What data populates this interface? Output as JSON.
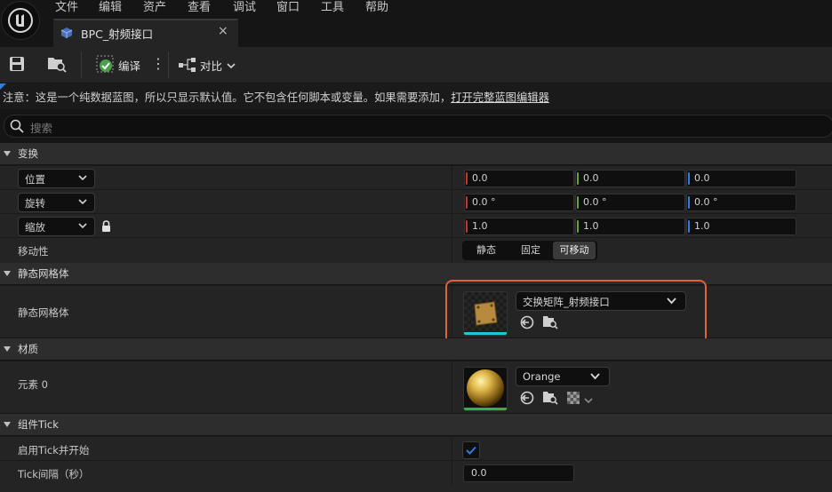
{
  "menu": [
    "文件",
    "编辑",
    "资产",
    "查看",
    "调试",
    "窗口",
    "工具",
    "帮助"
  ],
  "tab": {
    "title": "BPC_射频接口",
    "close": "×"
  },
  "toolbar": {
    "compile_label": "编译",
    "diff_label": "对比"
  },
  "notice": {
    "text": "注意：这是一个纯数据蓝图，所以只显示默认值。它不包含任何脚本或变量。如果需要添加，",
    "link": "打开完整蓝图编辑器"
  },
  "search": {
    "placeholder": "搜索"
  },
  "transform": {
    "category": "变换",
    "location": {
      "label": "位置",
      "x": "0.0",
      "y": "0.0",
      "z": "0.0"
    },
    "rotation": {
      "label": "旋转",
      "x": "0.0 °",
      "y": "0.0 °",
      "z": "0.0 °"
    },
    "scale": {
      "label": "缩放",
      "x": "1.0",
      "y": "1.0",
      "z": "1.0"
    },
    "mobility": {
      "label": "移动性",
      "options": [
        "静态",
        "固定",
        "可移动"
      ],
      "selected": "可移动"
    }
  },
  "static_mesh": {
    "category": "静态网格体",
    "label": "静态网格体",
    "asset": "交换矩阵_射频接口"
  },
  "materials": {
    "category": "材质",
    "label": "元素 0",
    "asset": "Orange"
  },
  "tick": {
    "category": "组件Tick",
    "start_label": "启用Tick并开始",
    "start_checked": true,
    "interval_label": "Tick间隔（秒）",
    "interval_value": "0.0"
  },
  "colors": {
    "x_axis": "#c8352a",
    "y_axis": "#6aa23a",
    "z_axis": "#2f7de0",
    "highlight": "#e0623a",
    "mesh_underline": "#1fc8d8",
    "mat_underline": "#36b04a",
    "checkbox": "#2f7de0"
  }
}
